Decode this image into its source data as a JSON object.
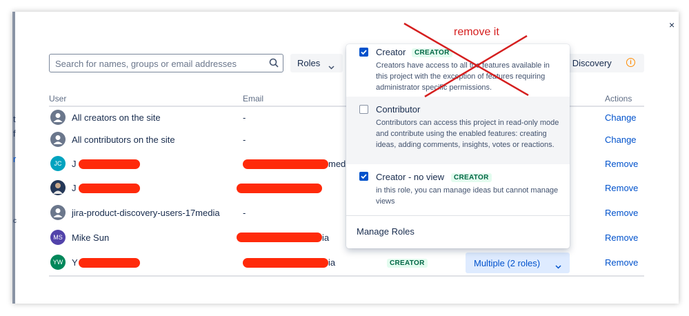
{
  "search": {
    "placeholder": "Search for names, groups or email addresses",
    "icon": "search-icon"
  },
  "filters": {
    "roles_label": "Roles",
    "product_label": "ct Discovery"
  },
  "table": {
    "headers": {
      "user": "User",
      "email": "Email",
      "actions": "Actions"
    },
    "rows": [
      {
        "name": "All creators on the site",
        "email": "-",
        "action": "Change"
      },
      {
        "name": "All contributors on the site",
        "email": "-",
        "action": "Change"
      },
      {
        "name": "J",
        "initials": "JC",
        "email_suffix": "med",
        "action": "Remove"
      },
      {
        "name": "J",
        "email": "",
        "action": "Remove"
      },
      {
        "name": "jira-product-discovery-users-17media",
        "email": "-",
        "action": "Remove"
      },
      {
        "name": "Mike Sun",
        "initials": "MS",
        "email_suffix": "ia",
        "action": "Remove"
      },
      {
        "name": "Y",
        "initials": "YW",
        "email_suffix": "ia",
        "role_badge": "CREATOR",
        "role_select": "Multiple (2 roles)",
        "action": "Remove"
      }
    ]
  },
  "dropdown": {
    "options": [
      {
        "title": "Creator",
        "badge": "CREATOR",
        "checked": true,
        "desc": "Creators have access to all the features available in this project with the exception of features requiring administrator specific permissions."
      },
      {
        "title": "Contributor",
        "checked": false,
        "desc": "Contributors can access this project in read-only mode and contribute using the enabled features: creating ideas, adding comments, insights, votes or reactions."
      },
      {
        "title": "Creator - no view",
        "badge": "CREATOR",
        "checked": true,
        "desc": "in this role, you can manage ideas but cannot manage views"
      }
    ],
    "manage_label": "Manage Roles"
  },
  "annotation": {
    "text": "remove it"
  },
  "close_glyph": "×",
  "side_fragments": [
    "t",
    "f",
    "r",
    "c"
  ],
  "colors": {
    "link": "#0052cc",
    "annotation": "#d51f1f",
    "redaction": "#ff2a0a",
    "lozenge_bg": "#e3fcef"
  }
}
